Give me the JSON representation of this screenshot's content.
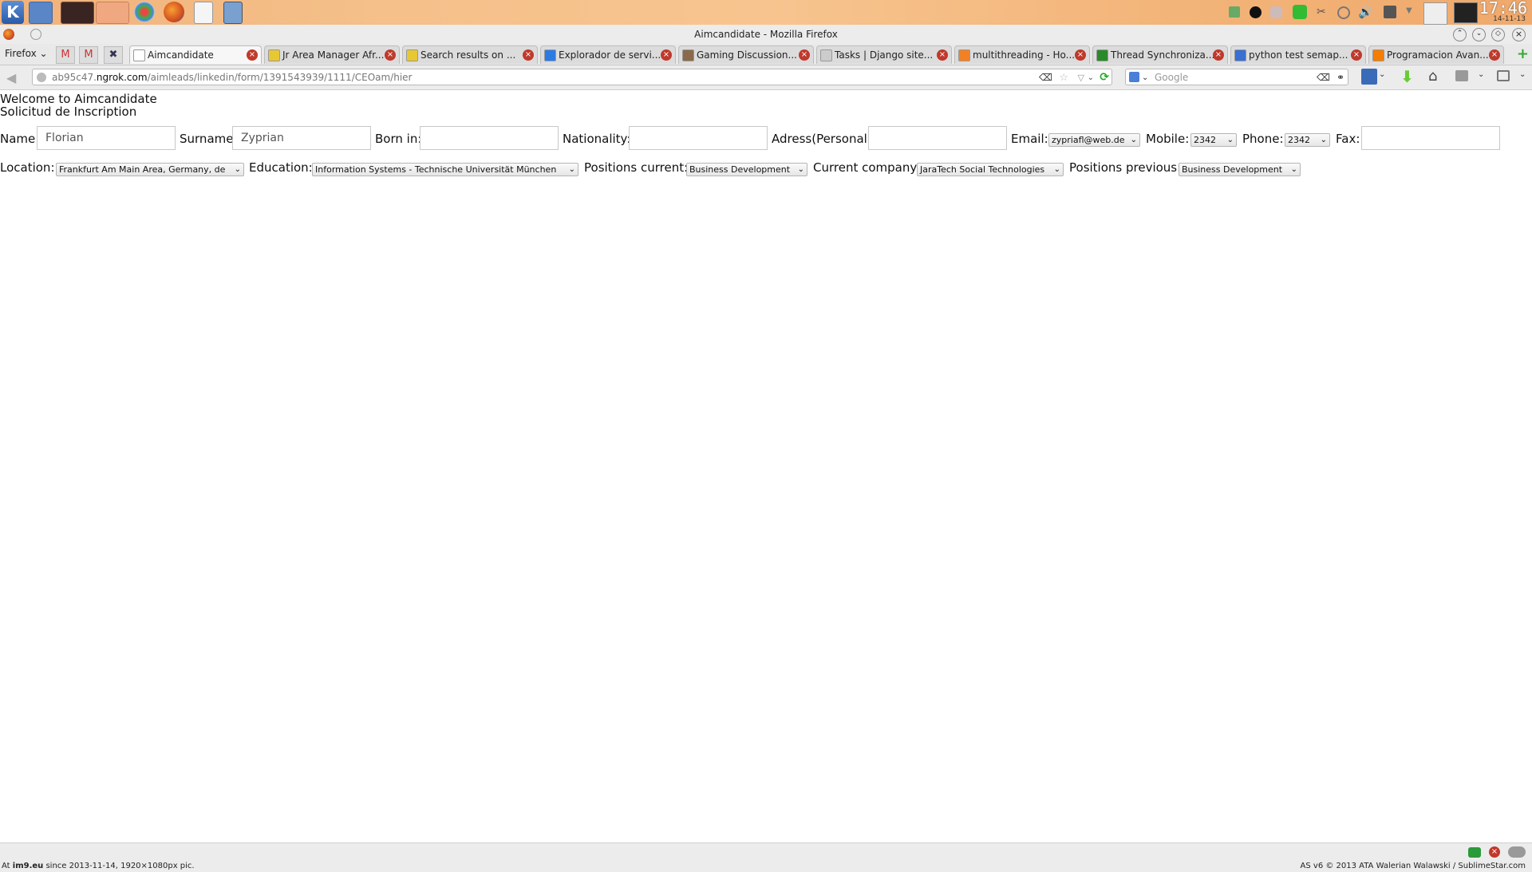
{
  "panel": {
    "clock_time": "17:46",
    "clock_date": "14-11-13"
  },
  "window": {
    "title": "Aimcandidate - Mozilla Firefox"
  },
  "firefox": {
    "menu_label": "Firefox"
  },
  "tabs": [
    {
      "label": "Aimcandidate",
      "active": true,
      "icon_color": "#ffffff"
    },
    {
      "label": "Jr Area Manager Afr...",
      "active": false,
      "icon_color": "#e8c832"
    },
    {
      "label": "Search results on ...",
      "active": false,
      "icon_color": "#e8c832"
    },
    {
      "label": "Explorador de servi...",
      "active": false,
      "icon_color": "#2c7be5"
    },
    {
      "label": "Gaming Discussion...",
      "active": false,
      "icon_color": "#8a6a4a"
    },
    {
      "label": "Tasks | Django site...",
      "active": false,
      "icon_color": "#cccccc"
    },
    {
      "label": "multithreading - Ho...",
      "active": false,
      "icon_color": "#f48024"
    },
    {
      "label": "Thread Synchroniza...",
      "active": false,
      "icon_color": "#2a8a2a"
    },
    {
      "label": "python test semap...",
      "active": false,
      "icon_color": "#3b6fd1"
    },
    {
      "label": "Programacion Avan...",
      "active": false,
      "icon_color": "#f57d00"
    }
  ],
  "url": {
    "prefix": "ab95c47.",
    "host": "ngrok.com",
    "path": "/aimleads/linkedin/form/1391543939/1111/CEOam/hier"
  },
  "search": {
    "placeholder": "Google"
  },
  "page": {
    "welcome": "Welcome to Aimcandidate",
    "subtitle": "Solicitud de Inscription",
    "labels": {
      "name": "Name:",
      "surname": "Surname:",
      "born_in": "Born in:",
      "nationality": "Nationality:",
      "address": "Adress(Personal):",
      "email": "Email:",
      "mobile": "Mobile:",
      "phone": "Phone:",
      "fax": "Fax:",
      "location": "Location:",
      "education": "Education:",
      "positions_current": "Positions current:",
      "current_company": "Current company:",
      "positions_previous": "Positions previous:"
    },
    "values": {
      "name": "Florian",
      "surname": "Zyprian",
      "born_in": "",
      "nationality": "",
      "address": "",
      "email": "zypriafl@web.de",
      "mobile": "2342",
      "phone": "2342",
      "fax": "",
      "location": "Frankfurt Am Main Area, Germany, de",
      "education": "Information Systems - Technische Universität München",
      "positions_current": "Business Development",
      "current_company": "JaraTech Social Technologies",
      "positions_previous": "Business Development"
    }
  },
  "footer": {
    "left_prefix": "At ",
    "left_site": "im9.eu",
    "left_rest": " since 2013-11-14, 1920×1080px pic.",
    "right": "AS v6 © 2013 ATA Walerian Walawski / SublimeStar.com"
  }
}
